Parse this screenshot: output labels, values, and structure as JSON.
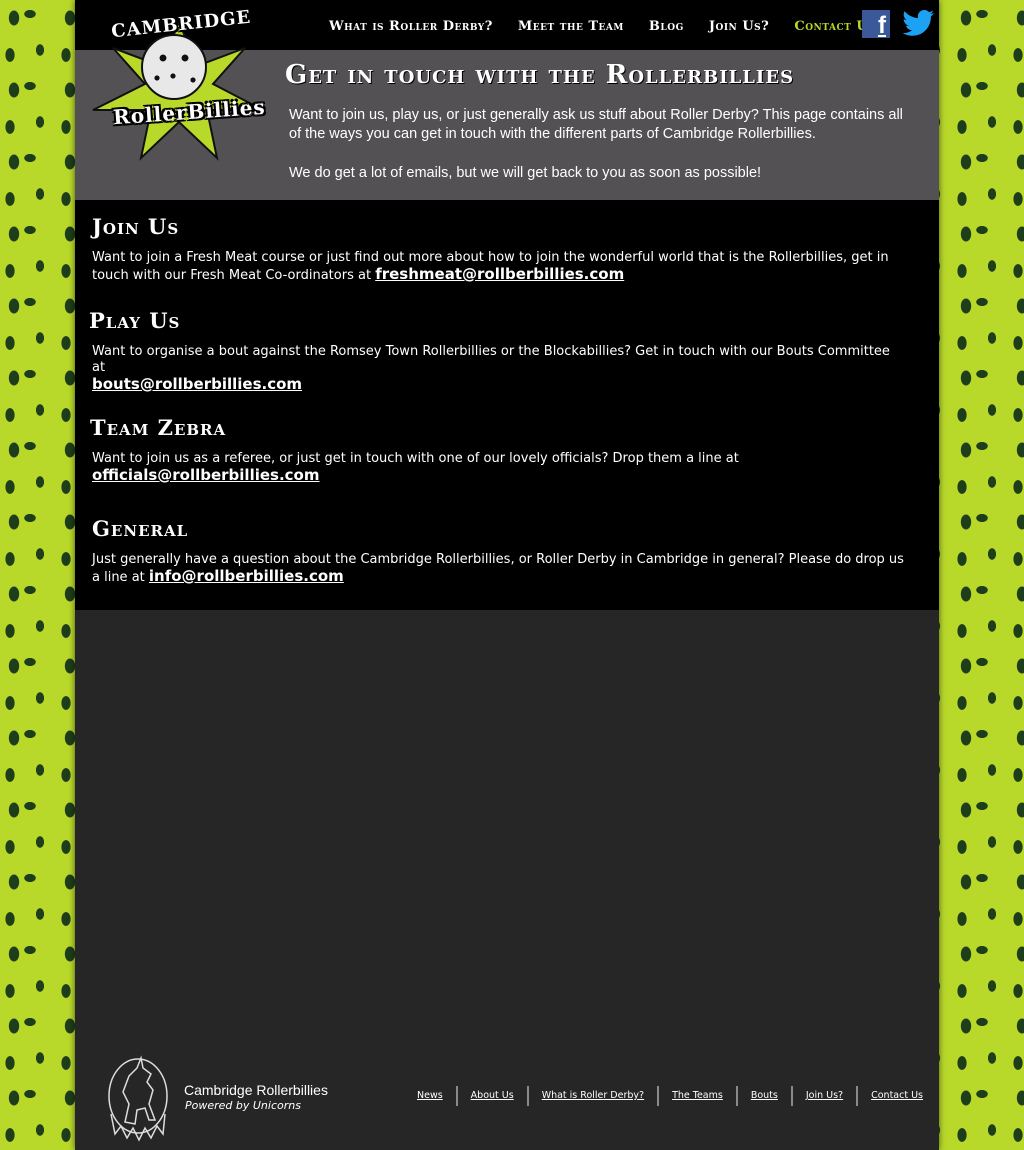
{
  "logo": {
    "line1": "CAMBRIDGE",
    "line2": "RollerBillies"
  },
  "nav": {
    "items": [
      "What is Roller Derby?",
      "Meet the Team",
      "Blog",
      "Join Us?",
      "Contact Us"
    ],
    "active": "Contact Us"
  },
  "social": {
    "facebook_glyph": "f",
    "icons": [
      "facebook-icon",
      "twitter-icon"
    ]
  },
  "hero": {
    "title": "Get in touch with the Rollerbillies",
    "paragraph1": "Want to join us, play us, or just generally ask us stuff about Roller Derby? This page contains all of the ways you can get in touch with the different parts of Cambridge Rollerbillies.",
    "paragraph2": "We do get a lot of emails, but we will get back to you as soon as possible!"
  },
  "sections": [
    {
      "title": "Join Us",
      "text": "Want to join a Fresh Meat course or just find out more about how to join the wonderful world that is the Rollerbillies, get in touch with our Fresh Meat Co-ordinators at ",
      "email": "freshmeat@rollberbillies.com"
    },
    {
      "title": "Play Us",
      "text": "Want to organise a bout against the Romsey Town Rollerbillies or the Blockabillies? Get in touch with our Bouts Committee at ",
      "email": "bouts@rollberbillies.com"
    },
    {
      "title": "Team Zebra",
      "text": "Want to join us as a referee, or just get in touch with one of our lovely officials? Drop them a line at ",
      "email": "officials@rollberbillies.com"
    },
    {
      "title": "General",
      "text": "Just generally have a question about the Cambridge Rollerbillies, or Roller Derby in Cambridge in general? Please do drop us a line at ",
      "email": "info@rollberbillies.com"
    }
  ],
  "footer": {
    "title": "Cambridge Rollerbillies",
    "tagline": "Powered by Unicorns",
    "links": [
      "News",
      "About Us",
      "What is Roller Derby?",
      "The Teams",
      "Bouts",
      "Join Us?",
      "Contact Us"
    ]
  },
  "colors": {
    "accent": "#b8d82a",
    "hero_bg": "#535153",
    "page_bg": "#272627",
    "facebook": "#3b5998",
    "twitter": "#1da1f2"
  }
}
